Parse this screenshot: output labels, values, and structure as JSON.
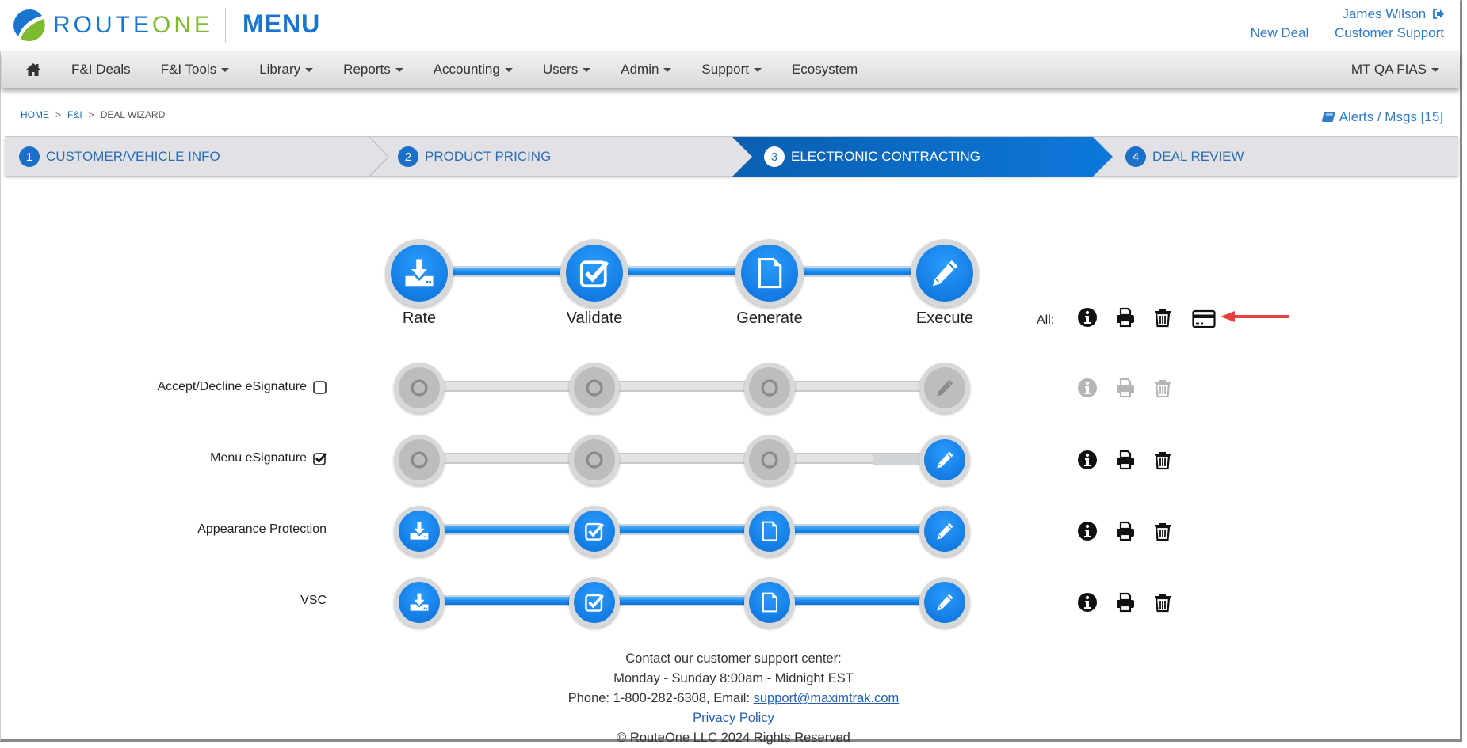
{
  "header": {
    "logo_text_route": "ROUTE",
    "logo_text_one": "ONE",
    "app_title": "MENU",
    "user_name": "James Wilson",
    "logout_icon": "sign-out-icon",
    "links": [
      "New Deal",
      "Customer Support"
    ]
  },
  "nav": {
    "home_icon": "home-icon",
    "items": [
      {
        "label": "F&I Deals",
        "dropdown": false
      },
      {
        "label": "F&I Tools",
        "dropdown": true
      },
      {
        "label": "Library",
        "dropdown": true
      },
      {
        "label": "Reports",
        "dropdown": true
      },
      {
        "label": "Accounting",
        "dropdown": true
      },
      {
        "label": "Users",
        "dropdown": true
      },
      {
        "label": "Admin",
        "dropdown": true
      },
      {
        "label": "Support",
        "dropdown": true
      },
      {
        "label": "Ecosystem",
        "dropdown": false
      }
    ],
    "dealer": "MT QA FIAS"
  },
  "breadcrumb": [
    {
      "label": "HOME",
      "link": true
    },
    {
      "label": "F&I",
      "link": true
    },
    {
      "label": "DEAL WIZARD",
      "link": false
    }
  ],
  "alerts": {
    "label": "Alerts / Msgs [15]",
    "icon": "book-icon"
  },
  "wizard_steps": [
    {
      "num": "1",
      "label": "CUSTOMER/VEHICLE INFO",
      "active": false
    },
    {
      "num": "2",
      "label": "PRODUCT PRICING",
      "active": false
    },
    {
      "num": "3",
      "label": "ELECTRONIC CONTRACTING",
      "active": true
    },
    {
      "num": "4",
      "label": "DEAL REVIEW",
      "active": false
    }
  ],
  "stages": [
    {
      "label": "Rate",
      "icon": "download-icon"
    },
    {
      "label": "Validate",
      "icon": "check-square-icon"
    },
    {
      "label": "Generate",
      "icon": "file-icon"
    },
    {
      "label": "Execute",
      "icon": "pencil-icon"
    }
  ],
  "all_actions": {
    "label": "All:",
    "icons": [
      "info-icon",
      "print-icon",
      "trash-icon",
      "credit-card-icon"
    ]
  },
  "products": [
    {
      "name": "Accept/Decline eSignature",
      "checkbox": "unchecked",
      "status": [
        "pending",
        "pending",
        "pending",
        "disabled"
      ],
      "actions_enabled": false
    },
    {
      "name": "Menu eSignature",
      "checkbox": "checked",
      "status": [
        "pending",
        "pending",
        "pending",
        "active"
      ],
      "actions_enabled": true
    },
    {
      "name": "Appearance Protection",
      "checkbox": null,
      "status": [
        "done",
        "done",
        "done",
        "active"
      ],
      "actions_enabled": true
    },
    {
      "name": "VSC",
      "checkbox": null,
      "status": [
        "done",
        "done",
        "done",
        "active"
      ],
      "actions_enabled": true
    }
  ],
  "footer": {
    "line1": "Contact our customer support center:",
    "line2": "Monday - Sunday 8:00am - Midnight EST",
    "phone_prefix": "Phone: 1-800-282-6308, Email: ",
    "email": "support@maximtrak.com",
    "privacy": "Privacy Policy",
    "copyright": "© RouteOne LLC 2024 Rights Reserved"
  },
  "colors": {
    "brand_blue": "#1a75cf",
    "brand_green": "#7cba2e",
    "active_step": "#0a6cc4",
    "annotation_arrow": "#e84040"
  }
}
